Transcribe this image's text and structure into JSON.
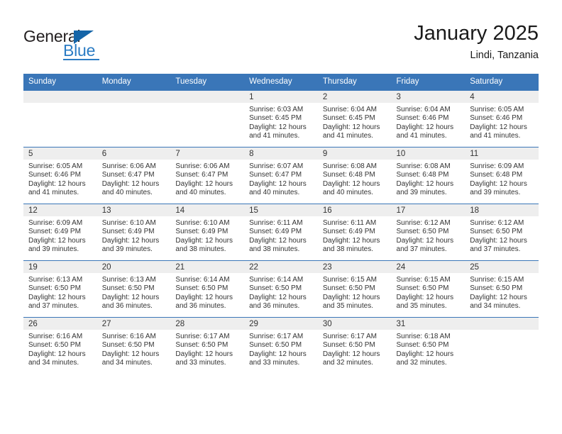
{
  "brand": {
    "name_part1": "General",
    "name_part2": "Blue"
  },
  "header": {
    "title": "January 2025",
    "subtitle": "Lindi, Tanzania"
  },
  "calendar": {
    "weekday_headers": [
      "Sunday",
      "Monday",
      "Tuesday",
      "Wednesday",
      "Thursday",
      "Friday",
      "Saturday"
    ],
    "colors": {
      "header_blue": "#3a76b8",
      "daynum_band": "#eeeeee",
      "brand_blue": "#2b7cc4",
      "text": "#333333"
    },
    "weeks": [
      [
        {
          "day": "",
          "lines": []
        },
        {
          "day": "",
          "lines": []
        },
        {
          "day": "",
          "lines": []
        },
        {
          "day": "1",
          "lines": [
            "Sunrise: 6:03 AM",
            "Sunset: 6:45 PM",
            "Daylight: 12 hours",
            "and 41 minutes."
          ]
        },
        {
          "day": "2",
          "lines": [
            "Sunrise: 6:04 AM",
            "Sunset: 6:45 PM",
            "Daylight: 12 hours",
            "and 41 minutes."
          ]
        },
        {
          "day": "3",
          "lines": [
            "Sunrise: 6:04 AM",
            "Sunset: 6:46 PM",
            "Daylight: 12 hours",
            "and 41 minutes."
          ]
        },
        {
          "day": "4",
          "lines": [
            "Sunrise: 6:05 AM",
            "Sunset: 6:46 PM",
            "Daylight: 12 hours",
            "and 41 minutes."
          ]
        }
      ],
      [
        {
          "day": "5",
          "lines": [
            "Sunrise: 6:05 AM",
            "Sunset: 6:46 PM",
            "Daylight: 12 hours",
            "and 41 minutes."
          ]
        },
        {
          "day": "6",
          "lines": [
            "Sunrise: 6:06 AM",
            "Sunset: 6:47 PM",
            "Daylight: 12 hours",
            "and 40 minutes."
          ]
        },
        {
          "day": "7",
          "lines": [
            "Sunrise: 6:06 AM",
            "Sunset: 6:47 PM",
            "Daylight: 12 hours",
            "and 40 minutes."
          ]
        },
        {
          "day": "8",
          "lines": [
            "Sunrise: 6:07 AM",
            "Sunset: 6:47 PM",
            "Daylight: 12 hours",
            "and 40 minutes."
          ]
        },
        {
          "day": "9",
          "lines": [
            "Sunrise: 6:08 AM",
            "Sunset: 6:48 PM",
            "Daylight: 12 hours",
            "and 40 minutes."
          ]
        },
        {
          "day": "10",
          "lines": [
            "Sunrise: 6:08 AM",
            "Sunset: 6:48 PM",
            "Daylight: 12 hours",
            "and 39 minutes."
          ]
        },
        {
          "day": "11",
          "lines": [
            "Sunrise: 6:09 AM",
            "Sunset: 6:48 PM",
            "Daylight: 12 hours",
            "and 39 minutes."
          ]
        }
      ],
      [
        {
          "day": "12",
          "lines": [
            "Sunrise: 6:09 AM",
            "Sunset: 6:49 PM",
            "Daylight: 12 hours",
            "and 39 minutes."
          ]
        },
        {
          "day": "13",
          "lines": [
            "Sunrise: 6:10 AM",
            "Sunset: 6:49 PM",
            "Daylight: 12 hours",
            "and 39 minutes."
          ]
        },
        {
          "day": "14",
          "lines": [
            "Sunrise: 6:10 AM",
            "Sunset: 6:49 PM",
            "Daylight: 12 hours",
            "and 38 minutes."
          ]
        },
        {
          "day": "15",
          "lines": [
            "Sunrise: 6:11 AM",
            "Sunset: 6:49 PM",
            "Daylight: 12 hours",
            "and 38 minutes."
          ]
        },
        {
          "day": "16",
          "lines": [
            "Sunrise: 6:11 AM",
            "Sunset: 6:49 PM",
            "Daylight: 12 hours",
            "and 38 minutes."
          ]
        },
        {
          "day": "17",
          "lines": [
            "Sunrise: 6:12 AM",
            "Sunset: 6:50 PM",
            "Daylight: 12 hours",
            "and 37 minutes."
          ]
        },
        {
          "day": "18",
          "lines": [
            "Sunrise: 6:12 AM",
            "Sunset: 6:50 PM",
            "Daylight: 12 hours",
            "and 37 minutes."
          ]
        }
      ],
      [
        {
          "day": "19",
          "lines": [
            "Sunrise: 6:13 AM",
            "Sunset: 6:50 PM",
            "Daylight: 12 hours",
            "and 37 minutes."
          ]
        },
        {
          "day": "20",
          "lines": [
            "Sunrise: 6:13 AM",
            "Sunset: 6:50 PM",
            "Daylight: 12 hours",
            "and 36 minutes."
          ]
        },
        {
          "day": "21",
          "lines": [
            "Sunrise: 6:14 AM",
            "Sunset: 6:50 PM",
            "Daylight: 12 hours",
            "and 36 minutes."
          ]
        },
        {
          "day": "22",
          "lines": [
            "Sunrise: 6:14 AM",
            "Sunset: 6:50 PM",
            "Daylight: 12 hours",
            "and 36 minutes."
          ]
        },
        {
          "day": "23",
          "lines": [
            "Sunrise: 6:15 AM",
            "Sunset: 6:50 PM",
            "Daylight: 12 hours",
            "and 35 minutes."
          ]
        },
        {
          "day": "24",
          "lines": [
            "Sunrise: 6:15 AM",
            "Sunset: 6:50 PM",
            "Daylight: 12 hours",
            "and 35 minutes."
          ]
        },
        {
          "day": "25",
          "lines": [
            "Sunrise: 6:15 AM",
            "Sunset: 6:50 PM",
            "Daylight: 12 hours",
            "and 34 minutes."
          ]
        }
      ],
      [
        {
          "day": "26",
          "lines": [
            "Sunrise: 6:16 AM",
            "Sunset: 6:50 PM",
            "Daylight: 12 hours",
            "and 34 minutes."
          ]
        },
        {
          "day": "27",
          "lines": [
            "Sunrise: 6:16 AM",
            "Sunset: 6:50 PM",
            "Daylight: 12 hours",
            "and 34 minutes."
          ]
        },
        {
          "day": "28",
          "lines": [
            "Sunrise: 6:17 AM",
            "Sunset: 6:50 PM",
            "Daylight: 12 hours",
            "and 33 minutes."
          ]
        },
        {
          "day": "29",
          "lines": [
            "Sunrise: 6:17 AM",
            "Sunset: 6:50 PM",
            "Daylight: 12 hours",
            "and 33 minutes."
          ]
        },
        {
          "day": "30",
          "lines": [
            "Sunrise: 6:17 AM",
            "Sunset: 6:50 PM",
            "Daylight: 12 hours",
            "and 32 minutes."
          ]
        },
        {
          "day": "31",
          "lines": [
            "Sunrise: 6:18 AM",
            "Sunset: 6:50 PM",
            "Daylight: 12 hours",
            "and 32 minutes."
          ]
        },
        {
          "day": "",
          "lines": []
        }
      ]
    ]
  }
}
